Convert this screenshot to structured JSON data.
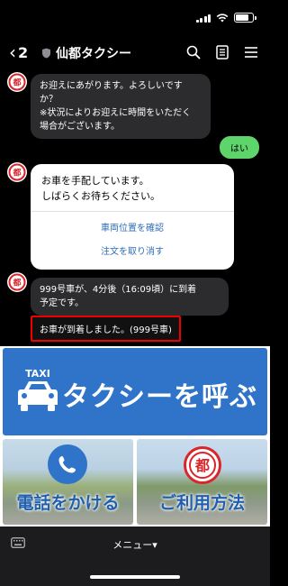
{
  "status_bar": {
    "time": ""
  },
  "header": {
    "back_count": "2",
    "title": "仙都タクシー"
  },
  "messages": {
    "greeting": [
      "お迎えにあがります。よろしいです",
      "か？",
      "※状況によりお迎えに時間をいただく",
      "場合がございます。"
    ],
    "reply": "はい",
    "arranging": [
      "お車を手配しています。",
      "しばらくお待ちください。"
    ],
    "check_location": "車両位置を確認",
    "cancel_order": "注文を取り消す",
    "eta": [
      "999号車が、4分後（16:09頃）に到着",
      "予定です。"
    ],
    "arrived": "お車が到着しました。(999号車)"
  },
  "rich_menu": {
    "taxi_badge": "TAXI",
    "call_taxi": "タクシーを呼ぶ",
    "call_phone": "電話をかける",
    "how_to_use": "ご利用方法",
    "logo_char": "都"
  },
  "bottom_bar": {
    "menu_label": "メニュー▾"
  },
  "colors": {
    "accent_blue": "#2f74c9",
    "reply_green": "#5ed56a",
    "highlight_red": "#e00000",
    "logo_red": "#d8262b"
  }
}
